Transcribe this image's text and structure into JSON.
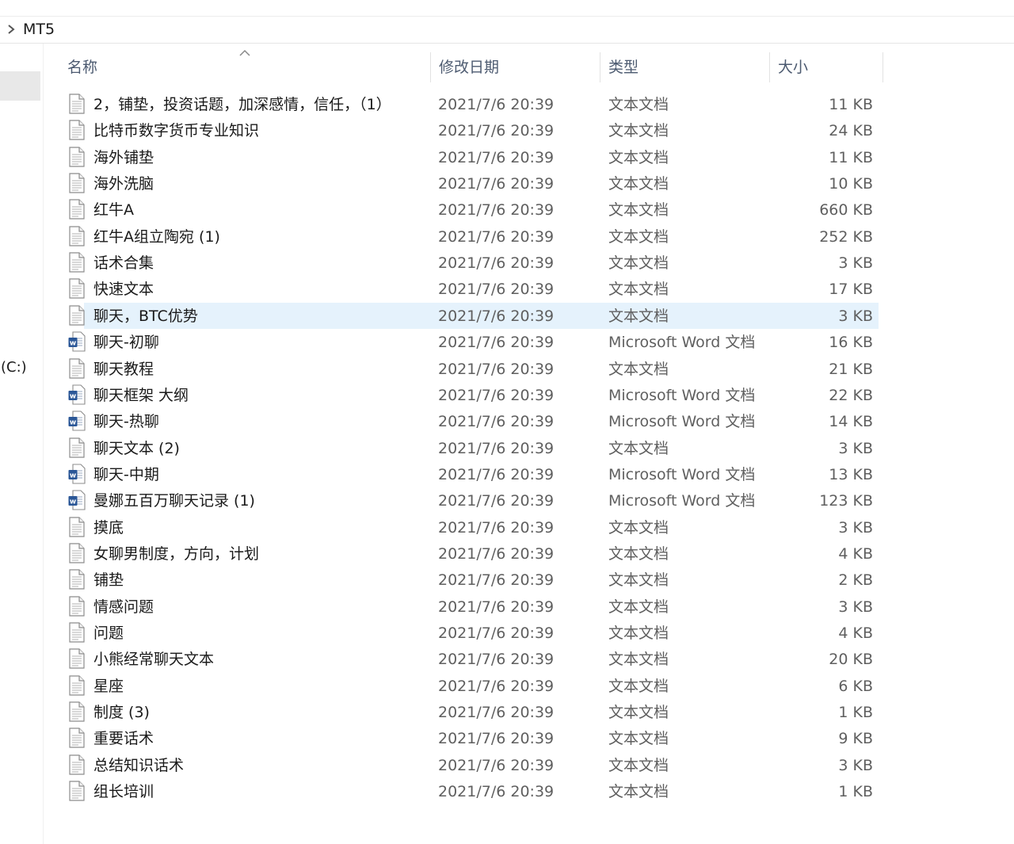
{
  "address": {
    "path": "MT5"
  },
  "nav": {
    "drive_label": "(C:)"
  },
  "columns": {
    "name": "名称",
    "date": "修改日期",
    "type": "类型",
    "size": "大小"
  },
  "files": [
    {
      "name": "2，铺垫，投资话题，加深感情，信任，（1）",
      "date": "2021/7/6 20:39",
      "type": "文本文档",
      "size": "11 KB",
      "icon": "text-file-icon"
    },
    {
      "name": "比特币数字货币专业知识",
      "date": "2021/7/6 20:39",
      "type": "文本文档",
      "size": "24 KB",
      "icon": "text-file-icon"
    },
    {
      "name": "海外铺垫",
      "date": "2021/7/6 20:39",
      "type": "文本文档",
      "size": "11 KB",
      "icon": "text-file-icon"
    },
    {
      "name": "海外洗脑",
      "date": "2021/7/6 20:39",
      "type": "文本文档",
      "size": "10 KB",
      "icon": "text-file-icon"
    },
    {
      "name": "红牛A",
      "date": "2021/7/6 20:39",
      "type": "文本文档",
      "size": "660 KB",
      "icon": "text-file-icon"
    },
    {
      "name": "红牛A组立陶宛 (1)",
      "date": "2021/7/6 20:39",
      "type": "文本文档",
      "size": "252 KB",
      "icon": "text-file-icon"
    },
    {
      "name": "话术合集",
      "date": "2021/7/6 20:39",
      "type": "文本文档",
      "size": "3 KB",
      "icon": "text-file-icon"
    },
    {
      "name": "快速文本",
      "date": "2021/7/6 20:39",
      "type": "文本文档",
      "size": "17 KB",
      "icon": "text-file-icon"
    },
    {
      "name": "聊天，BTC优势",
      "date": "2021/7/6 20:39",
      "type": "文本文档",
      "size": "3 KB",
      "icon": "text-file-icon",
      "selected": true
    },
    {
      "name": "聊天-初聊",
      "date": "2021/7/6 20:39",
      "type": "Microsoft Word 文档",
      "size": "16 KB",
      "icon": "word-file-icon"
    },
    {
      "name": "聊天教程",
      "date": "2021/7/6 20:39",
      "type": "文本文档",
      "size": "21 KB",
      "icon": "text-file-icon"
    },
    {
      "name": "聊天框架 大纲",
      "date": "2021/7/6 20:39",
      "type": "Microsoft Word 文档",
      "size": "22 KB",
      "icon": "word-file-icon"
    },
    {
      "name": "聊天-热聊",
      "date": "2021/7/6 20:39",
      "type": "Microsoft Word 文档",
      "size": "14 KB",
      "icon": "word-file-icon"
    },
    {
      "name": "聊天文本 (2)",
      "date": "2021/7/6 20:39",
      "type": "文本文档",
      "size": "3 KB",
      "icon": "text-file-icon"
    },
    {
      "name": "聊天-中期",
      "date": "2021/7/6 20:39",
      "type": "Microsoft Word 文档",
      "size": "13 KB",
      "icon": "word-file-icon"
    },
    {
      "name": "曼娜五百万聊天记录 (1)",
      "date": "2021/7/6 20:39",
      "type": "Microsoft Word 文档",
      "size": "123 KB",
      "icon": "word-file-icon"
    },
    {
      "name": "摸底",
      "date": "2021/7/6 20:39",
      "type": "文本文档",
      "size": "3 KB",
      "icon": "text-file-icon"
    },
    {
      "name": "女聊男制度，方向，计划",
      "date": "2021/7/6 20:39",
      "type": "文本文档",
      "size": "4 KB",
      "icon": "text-file-icon"
    },
    {
      "name": "铺垫",
      "date": "2021/7/6 20:39",
      "type": "文本文档",
      "size": "2 KB",
      "icon": "text-file-icon"
    },
    {
      "name": "情感问题",
      "date": "2021/7/6 20:39",
      "type": "文本文档",
      "size": "3 KB",
      "icon": "text-file-icon"
    },
    {
      "name": "问题",
      "date": "2021/7/6 20:39",
      "type": "文本文档",
      "size": "4 KB",
      "icon": "text-file-icon"
    },
    {
      "name": "小熊经常聊天文本",
      "date": "2021/7/6 20:39",
      "type": "文本文档",
      "size": "20 KB",
      "icon": "text-file-icon"
    },
    {
      "name": "星座",
      "date": "2021/7/6 20:39",
      "type": "文本文档",
      "size": "6 KB",
      "icon": "text-file-icon"
    },
    {
      "name": "制度 (3)",
      "date": "2021/7/6 20:39",
      "type": "文本文档",
      "size": "1 KB",
      "icon": "text-file-icon"
    },
    {
      "name": "重要话术",
      "date": "2021/7/6 20:39",
      "type": "文本文档",
      "size": "9 KB",
      "icon": "text-file-icon"
    },
    {
      "name": "总结知识话术",
      "date": "2021/7/6 20:39",
      "type": "文本文档",
      "size": "3 KB",
      "icon": "text-file-icon"
    },
    {
      "name": "组长培训",
      "date": "2021/7/6 20:39",
      "type": "文本文档",
      "size": "1 KB",
      "icon": "text-file-icon"
    }
  ]
}
